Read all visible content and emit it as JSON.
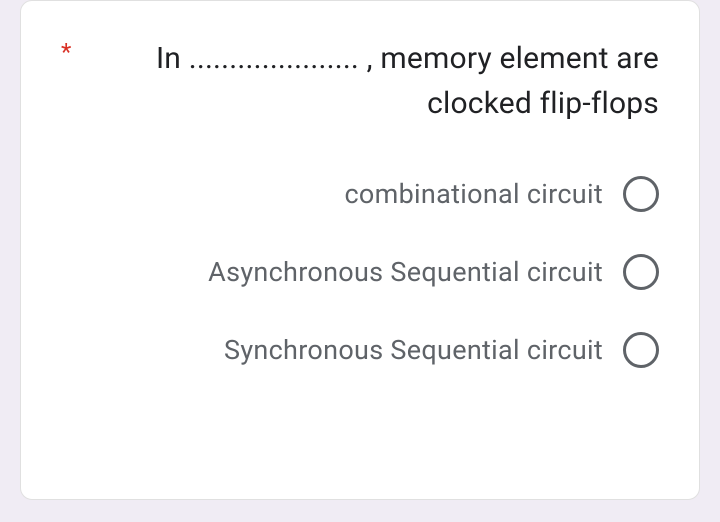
{
  "question": {
    "required_marker": "*",
    "text": "In ..................... , memory element are clocked flip-flops"
  },
  "options": [
    {
      "label": "combinational circuit"
    },
    {
      "label": "Asynchronous Sequential circuit"
    },
    {
      "label": "Synchronous Sequential circuit"
    }
  ]
}
